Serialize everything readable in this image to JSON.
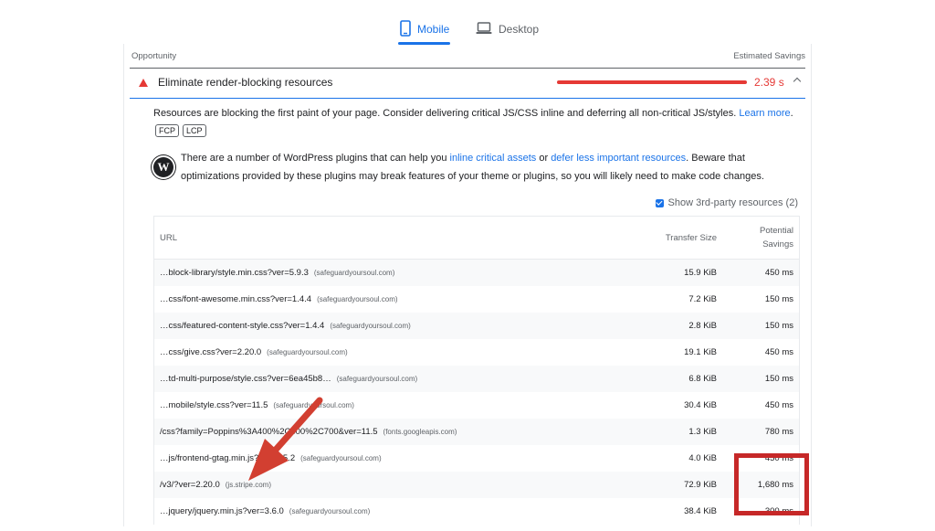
{
  "tabs": [
    {
      "label": "Mobile",
      "active": true,
      "icon": "phone-icon"
    },
    {
      "label": "Desktop",
      "active": false,
      "icon": "laptop-icon"
    }
  ],
  "header": {
    "opportunity": "Opportunity",
    "estimated_savings": "Estimated Savings"
  },
  "audit": {
    "title": "Eliminate render-blocking resources",
    "savings": "2.39 s",
    "status_color": "#e53935"
  },
  "description": {
    "text": "Resources are blocking the first paint of your page. Consider delivering critical JS/CSS inline and deferring all non-critical JS/styles. ",
    "learn_more": "Learn more",
    "end": ".",
    "chips": [
      "FCP",
      "LCP"
    ]
  },
  "wp_note": {
    "part1": "There are a number of WordPress plugins that can help you ",
    "link1": "inline critical assets",
    "part2": " or ",
    "link2": "defer less important resources",
    "part3": ". Beware that optimizations provided by these plugins may break features of your theme or plugins, so you will likely need to make code changes."
  },
  "third_party": {
    "label": "Show 3rd-party resources (2)",
    "checked": true
  },
  "table": {
    "col_url": "URL",
    "col_size": "Transfer Size",
    "col_savings_1": "Potential",
    "col_savings_2": "Savings",
    "rows": [
      {
        "url": "…block-library/style.min.css?ver=5.9.3",
        "host": "(safeguardyoursoul.com)",
        "size": "15.9 KiB",
        "savings": "450 ms"
      },
      {
        "url": "…css/font-awesome.min.css?ver=1.4.4",
        "host": "(safeguardyoursoul.com)",
        "size": "7.2 KiB",
        "savings": "150 ms"
      },
      {
        "url": "…css/featured-content-style.css?ver=1.4.4",
        "host": "(safeguardyoursoul.com)",
        "size": "2.8 KiB",
        "savings": "150 ms"
      },
      {
        "url": "…css/give.css?ver=2.20.0",
        "host": "(safeguardyoursoul.com)",
        "size": "19.1 KiB",
        "savings": "450 ms"
      },
      {
        "url": "…td-multi-purpose/style.css?ver=6ea45b8…",
        "host": "(safeguardyoursoul.com)",
        "size": "6.8 KiB",
        "savings": "150 ms"
      },
      {
        "url": "…mobile/style.css?ver=11.5",
        "host": "(safeguardyoursoul.com)",
        "size": "30.4 KiB",
        "savings": "450 ms"
      },
      {
        "url": "/css?family=Poppins%3A400%2C500%2C700&ver=11.5",
        "host": "(fonts.googleapis.com)",
        "size": "1.3 KiB",
        "savings": "780 ms"
      },
      {
        "url": "…js/frontend-gtag.min.js?ver=8.5.2",
        "host": "(safeguardyoursoul.com)",
        "size": "4.0 KiB",
        "savings": "450 ms"
      },
      {
        "url": "/v3/?ver=2.20.0",
        "host": "(js.stripe.com)",
        "size": "72.9 KiB",
        "savings": "1,680 ms"
      },
      {
        "url": "…jquery/jquery.min.js?ver=3.6.0",
        "host": "(safeguardyoursoul.com)",
        "size": "38.4 KiB",
        "savings": "300 ms"
      }
    ]
  },
  "colors": {
    "accent": "#1a73e8",
    "fail": "#e53935",
    "annotation": "#c62828"
  }
}
